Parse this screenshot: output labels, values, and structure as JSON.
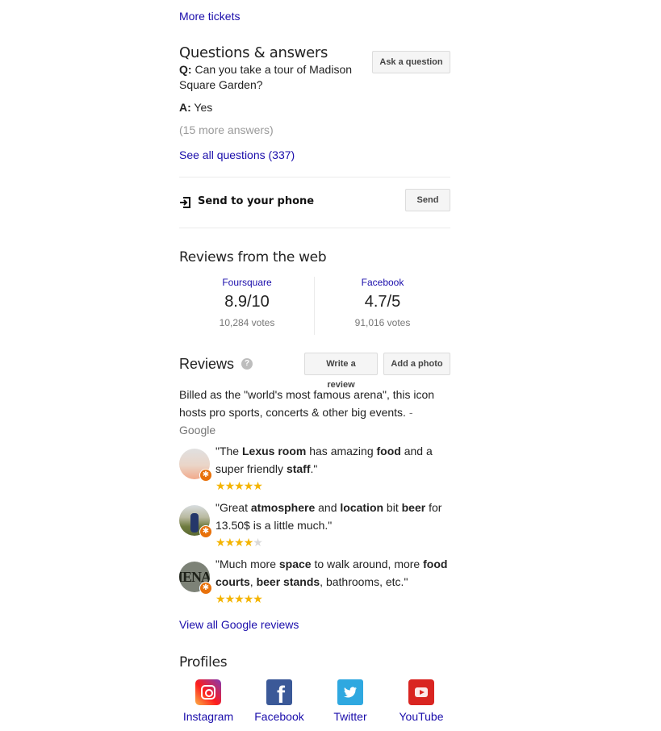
{
  "tickets": {
    "more_label": "More tickets"
  },
  "qa": {
    "title": "Questions & answers",
    "ask_button": "Ask a question",
    "q_prefix": "Q:",
    "question": "Can you take a tour of Madison Square Garden?",
    "a_prefix": "A:",
    "answer": "Yes",
    "more_answers": "(15 more answers)",
    "see_all": "See all questions (337)"
  },
  "send": {
    "label": "Send to your phone",
    "button": "Send",
    "icon": "send-to-phone-icon"
  },
  "web_reviews": {
    "title": "Reviews from the web",
    "sources": [
      {
        "name": "Foursquare",
        "score": "8.9/10",
        "votes": "10,284 votes"
      },
      {
        "name": "Facebook",
        "score": "4.7/5",
        "votes": "91,016 votes"
      }
    ]
  },
  "reviews": {
    "title": "Reviews",
    "help_icon": "question-mark-icon",
    "write_button": "Write a review",
    "photo_button": "Add a photo",
    "summary": "Billed as the \"world's most famous arena\", this icon hosts pro sports, concerts & other big events.",
    "summary_source": "- Google",
    "items": [
      {
        "text_parts": [
          "\"The ",
          "Lexus room",
          " has amazing ",
          "food",
          " and a super friendly ",
          "staff",
          ".\""
        ],
        "rating": 5
      },
      {
        "text_parts": [
          "\"Great ",
          "atmosphere",
          " and ",
          "location",
          " bit ",
          "beer",
          " for 13.50$ is a little much.\""
        ],
        "rating": 4
      },
      {
        "text_parts": [
          "\"Much more ",
          "space",
          " to walk around, more ",
          "food courts",
          ", ",
          "beer stands",
          ", bathrooms, etc.\""
        ],
        "rating": 5
      }
    ],
    "view_all": "View all Google reviews"
  },
  "profiles": {
    "title": "Profiles",
    "items": [
      {
        "label": "Instagram",
        "color": "#c13584"
      },
      {
        "label": "Facebook",
        "color": "#3b5998"
      },
      {
        "label": "Twitter",
        "color": "#2fa8e0"
      },
      {
        "label": "YouTube",
        "color": "#d92521"
      }
    ]
  }
}
